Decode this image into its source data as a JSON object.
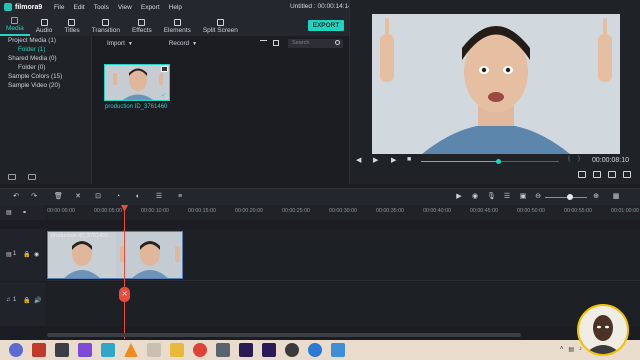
{
  "app": {
    "logo_text": "filmora9",
    "title": "Untitled : 00:00:14:14"
  },
  "menu": [
    "File",
    "Edit",
    "Tools",
    "View",
    "Export",
    "Help"
  ],
  "toolbar": {
    "tabs": [
      {
        "label": "Media",
        "icon": "folder-icon"
      },
      {
        "label": "Audio",
        "icon": "music-icon"
      },
      {
        "label": "Titles",
        "icon": "text-icon"
      },
      {
        "label": "Transition",
        "icon": "transition-icon"
      },
      {
        "label": "Effects",
        "icon": "effects-icon"
      },
      {
        "label": "Elements",
        "icon": "elements-icon"
      },
      {
        "label": "Split Screen",
        "icon": "split-screen-icon"
      }
    ],
    "export_label": "EXPORT"
  },
  "sidebar": {
    "items": [
      {
        "label": "Project Media (1)"
      },
      {
        "label": "Folder (1)"
      },
      {
        "label": "Shared Media (0)"
      },
      {
        "label": "Folder (0)"
      },
      {
        "label": "Sample Colors (15)"
      },
      {
        "label": "Sample Video (20)"
      }
    ]
  },
  "media": {
    "import_label": "Import",
    "record_label": "Record",
    "search_placeholder": "Search",
    "clip_name": "production ID_3761460"
  },
  "preview": {
    "timecode": "00:00:08:10",
    "progress_fraction": 0.56
  },
  "timeline": {
    "ruler_ticks": [
      "00:00:00:00",
      "00:00:05:00",
      "00:00:10:00",
      "00:00:15:00",
      "00:00:20:00",
      "00:00:25:00",
      "00:00:30:00",
      "00:00:35:00",
      "00:00:40:00",
      "00:00:45:00",
      "00:00:50:00",
      "00:00:55:00",
      "00:01:00:00"
    ],
    "video_track_label": "1",
    "audio_track_label": "1",
    "clip_label": "production ID_3761460",
    "zoom_fraction": 0.6
  },
  "colors": {
    "accent": "#21d4c3",
    "playhead": "#e84c3d",
    "background": "#1b1d22"
  }
}
